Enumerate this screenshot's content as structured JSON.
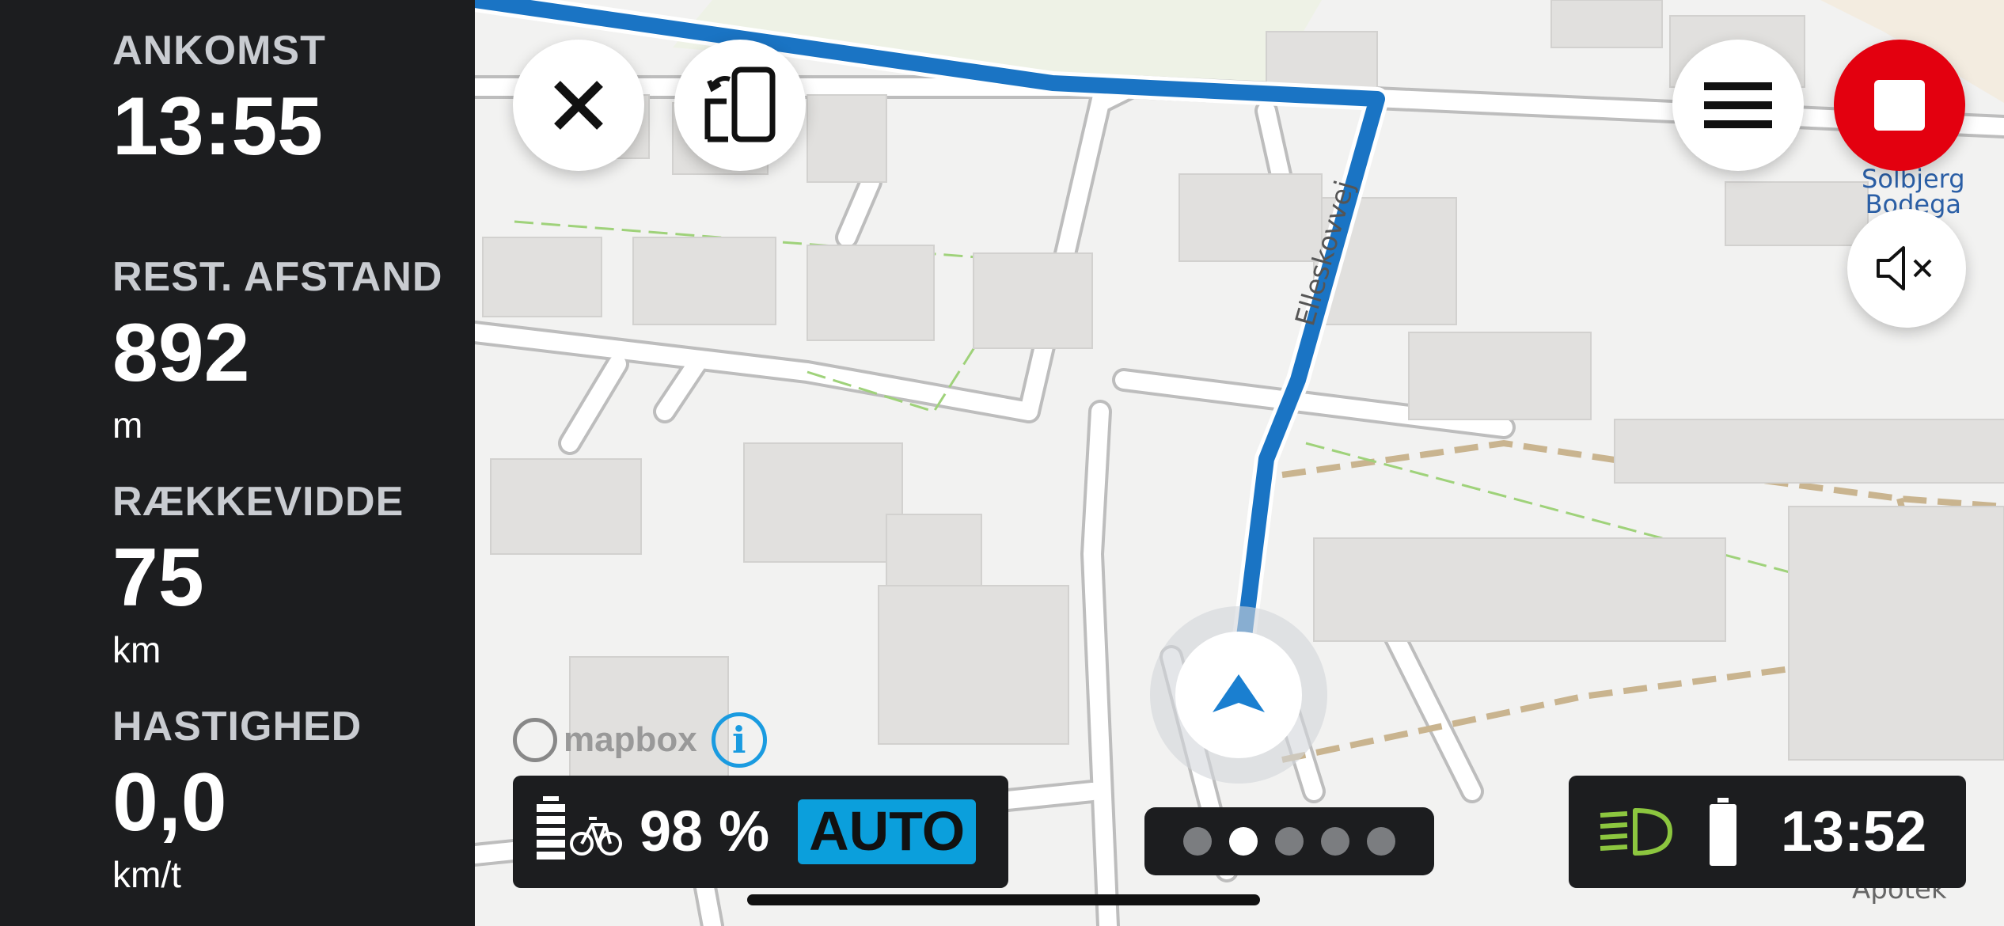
{
  "stats": {
    "arrival": {
      "label": "ANKOMST",
      "value": "13:55"
    },
    "remaining": {
      "label": "REST. AFSTAND",
      "value": "892",
      "unit": "m"
    },
    "range": {
      "label": "RÆKKEVIDDE",
      "value": "75",
      "unit": "km"
    },
    "speed": {
      "label": "HASTIGHED",
      "value": "0,0",
      "unit": "km/t"
    }
  },
  "map": {
    "street_name": "Elleskovvej",
    "poi_name_line1": "Solbjerg",
    "poi_name_line2": "Bodega",
    "poi_bottom": "Apotek",
    "attribution": "mapbox",
    "info_symbol": "i",
    "route_color": "#1a74c4"
  },
  "buttons": {
    "close_icon": "close-icon",
    "phone_icon": "phone-switch-icon",
    "menu_icon": "hamburger-menu-icon",
    "stop_icon": "stop-icon",
    "mute_icon": "speaker-muted-icon",
    "stop_color": "#e3000f"
  },
  "bottom_left": {
    "battery_percent": "98 %",
    "mode": "AUTO",
    "mode_color": "#0b9fdc"
  },
  "pager": {
    "count": 5,
    "active_index": 1
  },
  "bottom_right": {
    "light_icon": "headlight-icon",
    "light_color": "#8cc63f",
    "time": "13:52"
  }
}
